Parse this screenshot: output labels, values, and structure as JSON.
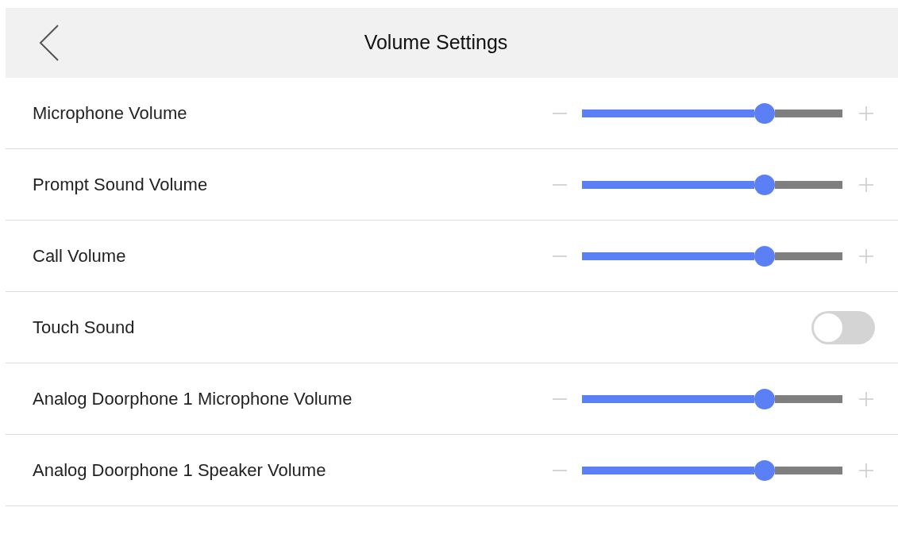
{
  "header": {
    "title": "Volume Settings"
  },
  "settings": [
    {
      "kind": "slider",
      "label": "Microphone Volume",
      "level": 0.7
    },
    {
      "kind": "slider",
      "label": "Prompt Sound Volume",
      "level": 0.7
    },
    {
      "kind": "slider",
      "label": "Call Volume",
      "level": 0.7
    },
    {
      "kind": "toggle",
      "label": "Touch Sound",
      "on": false
    },
    {
      "kind": "slider",
      "label": "Analog Doorphone 1 Microphone Volume",
      "level": 0.7
    },
    {
      "kind": "slider",
      "label": "Analog Doorphone 1 Speaker Volume",
      "level": 0.7
    }
  ]
}
